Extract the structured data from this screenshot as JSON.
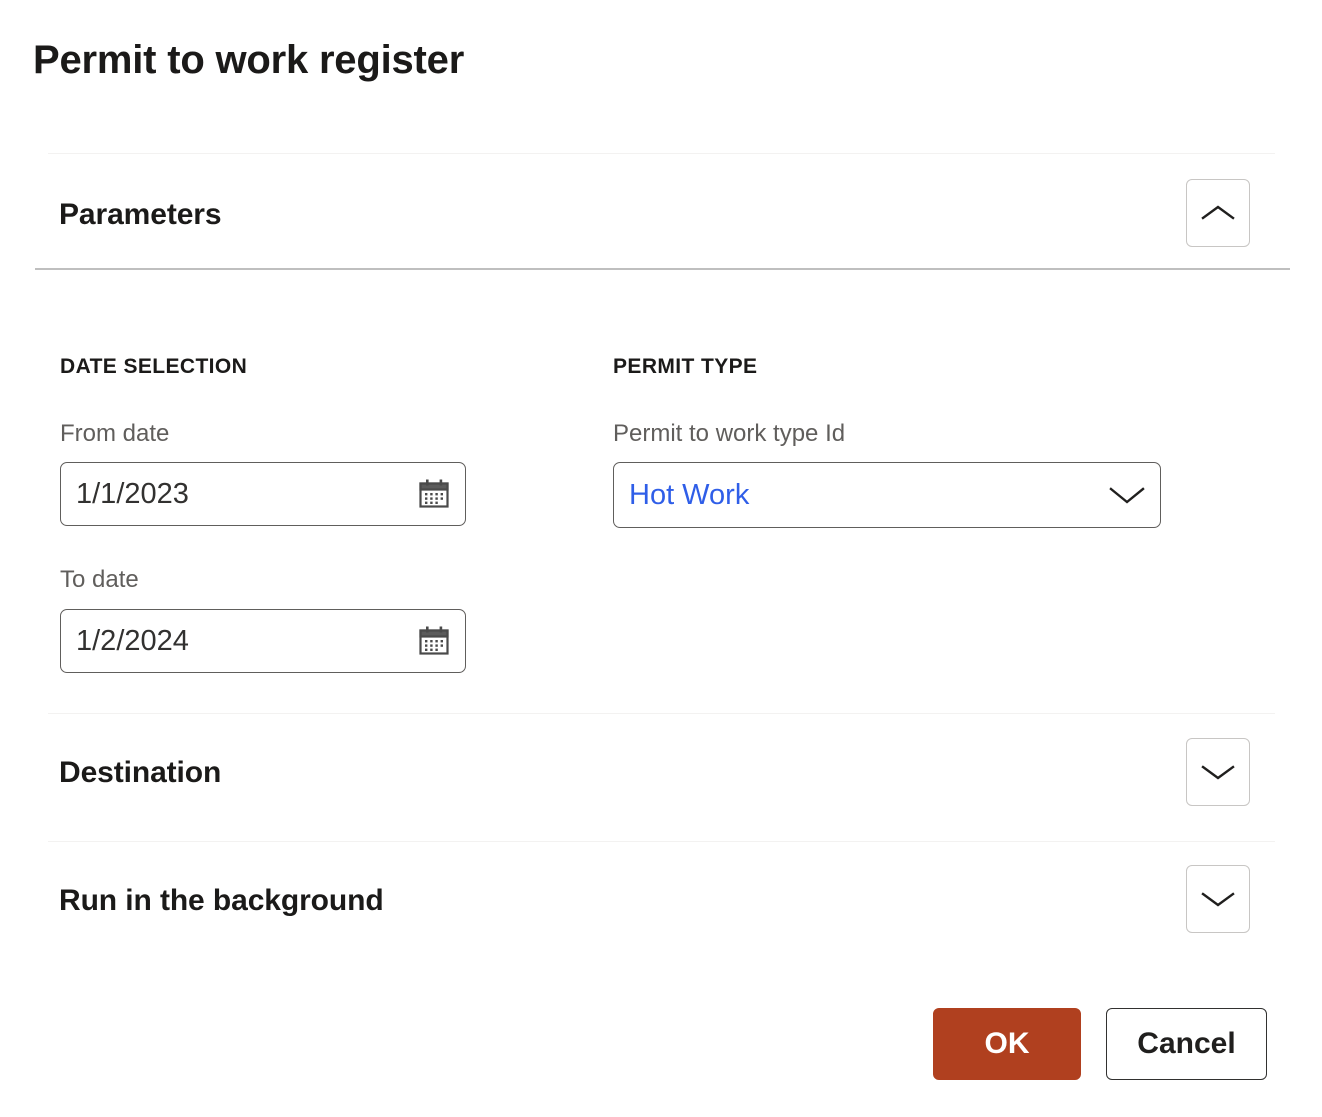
{
  "page": {
    "title": "Permit to work register"
  },
  "sections": {
    "parameters": {
      "title": "Parameters",
      "toggle_icon": "chevron-up-icon",
      "expanded": true
    },
    "destination": {
      "title": "Destination",
      "toggle_icon": "chevron-down-icon",
      "expanded": false
    },
    "background": {
      "title": "Run in the background",
      "toggle_icon": "chevron-down-icon",
      "expanded": false
    }
  },
  "parameters": {
    "date_selection": {
      "group_label": "DATE SELECTION",
      "fields": [
        {
          "label": "From date",
          "value": "1/1/2023",
          "icon": "calendar-icon"
        },
        {
          "label": "To date",
          "value": "1/2/2024",
          "icon": "calendar-icon"
        }
      ]
    },
    "permit_type": {
      "group_label": "PERMIT TYPE",
      "fields": [
        {
          "label": "Permit to work type Id",
          "value": "Hot Work",
          "icon": "chevron-down-icon"
        }
      ]
    }
  },
  "footer": {
    "ok_label": "OK",
    "cancel_label": "Cancel"
  },
  "colors": {
    "primary_button": "#b0401f",
    "link_text": "#2f5ee8",
    "label_text": "#605e5c",
    "divider_strong": "#bfbfbf",
    "divider_light": "#f3f2f1"
  }
}
